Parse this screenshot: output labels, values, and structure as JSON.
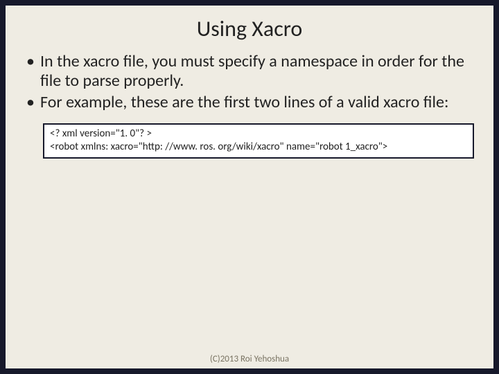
{
  "slide": {
    "title": "Using Xacro",
    "bullets": [
      "In the xacro file, you must specify a namespace in order for the file to parse properly.",
      "For example, these are the first two lines of a valid xacro file:"
    ],
    "code_lines": [
      "<? xml version=\"1. 0\"? >",
      "<robot xmlns: xacro=\"http: //www. ros. org/wiki/xacro\" name=\"robot 1_xacro\">"
    ],
    "footer": "(C)2013 Roi Yehoshua"
  }
}
